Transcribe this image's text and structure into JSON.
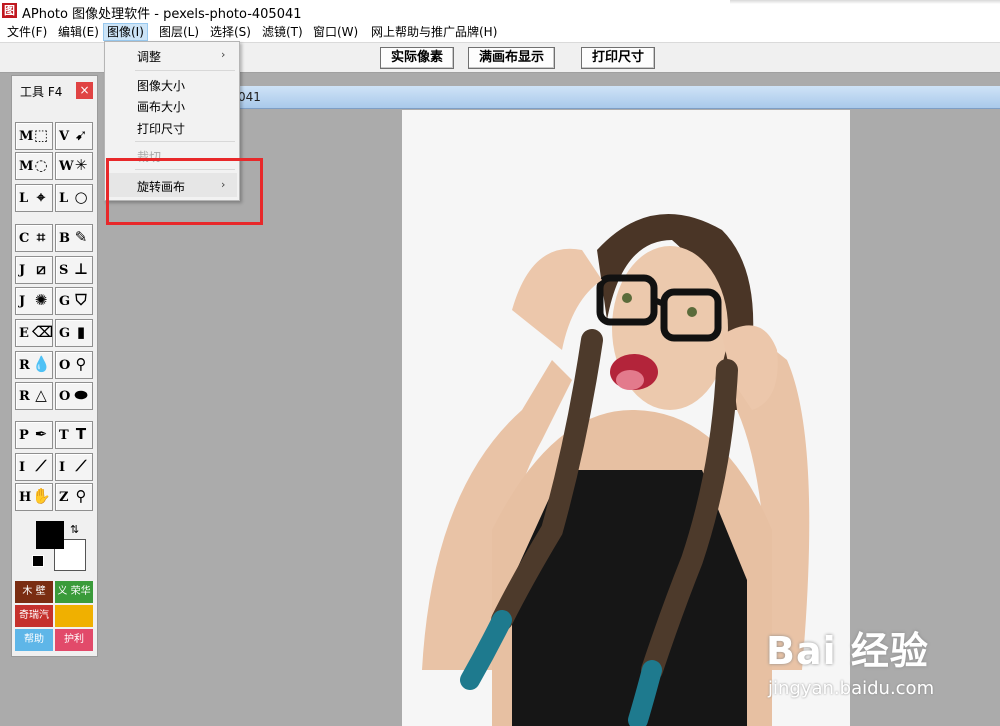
{
  "window": {
    "title": "APhoto 图像处理软件 - pexels-photo-405041",
    "icon": "图"
  },
  "menu": [
    {
      "label": "文件(F)",
      "active": false
    },
    {
      "label": "编辑(E)",
      "active": false
    },
    {
      "label": "图像(I)",
      "active": true
    },
    {
      "label": "图层(L)",
      "active": false
    },
    {
      "label": "选择(S)",
      "active": false
    },
    {
      "label": "滤镜(T)",
      "active": false
    },
    {
      "label": "窗口(W)",
      "active": false
    },
    {
      "label": "网上帮助与推广品牌(H)",
      "active": false
    }
  ],
  "toolbar": {
    "actual_pixels": "实际像素",
    "fit_canvas": "满画布显示",
    "print_size": "打印尺寸"
  },
  "document": {
    "title_fragment": "041"
  },
  "tools": {
    "title": "工具 F4",
    "close": "×",
    "buttons": [
      {
        "key": "M",
        "icon": "rect-marquee-icon"
      },
      {
        "key": "V",
        "icon": "move-tool-icon"
      },
      {
        "key": "M",
        "icon": "ellipse-marquee-icon"
      },
      {
        "key": "W",
        "icon": "magic-wand-icon"
      },
      {
        "key": "L",
        "icon": "polygon-lasso-icon"
      },
      {
        "key": "L",
        "icon": "lasso-icon"
      },
      {
        "key": "C",
        "icon": "crop-icon"
      },
      {
        "key": "B",
        "icon": "brush-icon"
      },
      {
        "key": "J",
        "icon": "bandage-icon"
      },
      {
        "key": "S",
        "icon": "stamp-icon"
      },
      {
        "key": "J",
        "icon": "red-eye-icon"
      },
      {
        "key": "G",
        "icon": "paint-bucket-icon"
      },
      {
        "key": "E",
        "icon": "eraser-icon"
      },
      {
        "key": "G",
        "icon": "gradient-icon"
      },
      {
        "key": "R",
        "icon": "blur-drop-icon"
      },
      {
        "key": "O",
        "icon": "dodge-icon"
      },
      {
        "key": "R",
        "icon": "sharpen-icon"
      },
      {
        "key": "O",
        "icon": "sponge-icon"
      },
      {
        "key": "P",
        "icon": "pen-icon"
      },
      {
        "key": "T",
        "icon": "text-tool-icon"
      },
      {
        "key": "I",
        "icon": "ruler-icon"
      },
      {
        "key": "I",
        "icon": "eyedropper-icon"
      },
      {
        "key": "H",
        "icon": "hand-icon"
      },
      {
        "key": "Z",
        "icon": "zoom-icon"
      }
    ],
    "colors": {
      "foreground": "#000000",
      "background": "#ffffff"
    },
    "ads": [
      "木 壁",
      "义 荣华",
      "奇瑞汽车",
      "",
      "帮助",
      "护利"
    ]
  },
  "image_menu": {
    "items": [
      {
        "label": "调整",
        "submenu": true,
        "disabled": false
      },
      {
        "label": "图像大小",
        "submenu": false,
        "disabled": false
      },
      {
        "label": "画布大小",
        "submenu": false,
        "disabled": false
      },
      {
        "label": "打印尺寸",
        "submenu": false,
        "disabled": false
      },
      {
        "label": "裁切",
        "submenu": false,
        "disabled": true
      },
      {
        "label": "旋转画布",
        "submenu": true,
        "disabled": false
      }
    ]
  },
  "watermark": {
    "main": "Bai 经验",
    "sub": "jingyan.baidu.com"
  }
}
